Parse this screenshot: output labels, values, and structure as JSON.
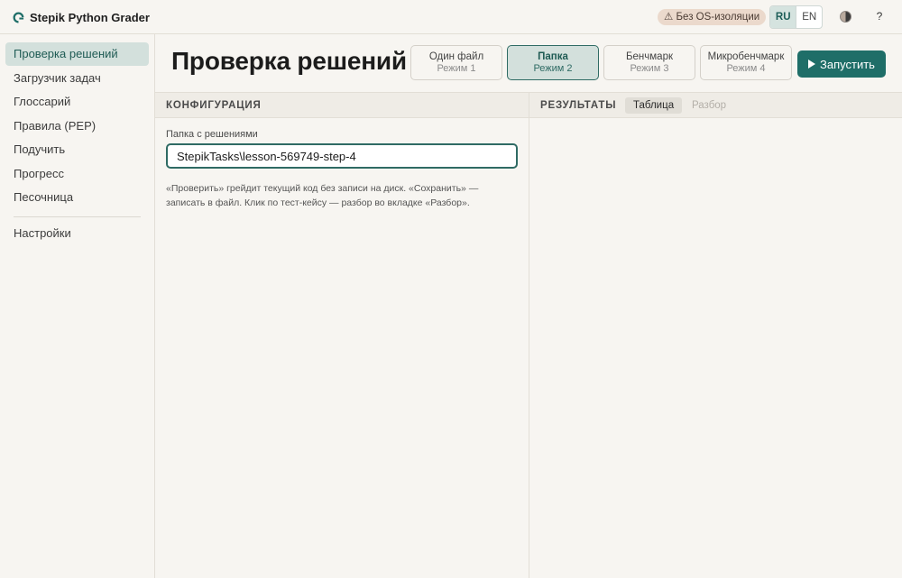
{
  "app": {
    "title": "Stepik Python Grader",
    "warning_badge": "⚠ Без OS-изоляции",
    "languages": [
      "RU",
      "EN"
    ],
    "active_language": "RU",
    "help_label": "?"
  },
  "sidebar": {
    "items": [
      {
        "label": "Проверка решений",
        "active": true
      },
      {
        "label": "Загрузчик задач",
        "active": false
      },
      {
        "label": "Глоссарий",
        "active": false
      },
      {
        "label": "Правила (PEP)",
        "active": false
      },
      {
        "label": "Подучить",
        "active": false
      },
      {
        "label": "Прогресс",
        "active": false
      },
      {
        "label": "Песочница",
        "active": false
      }
    ],
    "settings_label": "Настройки"
  },
  "header": {
    "title": "Проверка решений",
    "modes": [
      {
        "name": "Один файл",
        "sub": "Режим 1",
        "active": false
      },
      {
        "name": "Папка",
        "sub": "Режим 2",
        "active": true
      },
      {
        "name": "Бенчмарк",
        "sub": "Режим 3",
        "active": false
      },
      {
        "name": "Микробенчмарк",
        "sub": "Режим 4",
        "active": false
      }
    ],
    "run_label": "Запустить"
  },
  "config": {
    "title": "КОНФИГУРАЦИЯ",
    "folder_label": "Папка с решениями",
    "folder_value": "StepikTasks\\lesson-569749-step-4",
    "help_text": "«Проверить» грейдит текущий код без записи на диск. «Сохранить» — записать в файл. Клик по тест-кейсу — разбор во вкладке «Разбор»."
  },
  "results": {
    "title": "РЕЗУЛЬТАТЫ",
    "tabs": [
      {
        "label": "Таблица",
        "active": true
      },
      {
        "label": "Разбор",
        "active": false
      }
    ]
  },
  "colors": {
    "accent": "#1f6e68",
    "active_bg": "#d3e0dc",
    "warning_bg": "#ebd9cc",
    "background": "#f7f5f1"
  }
}
